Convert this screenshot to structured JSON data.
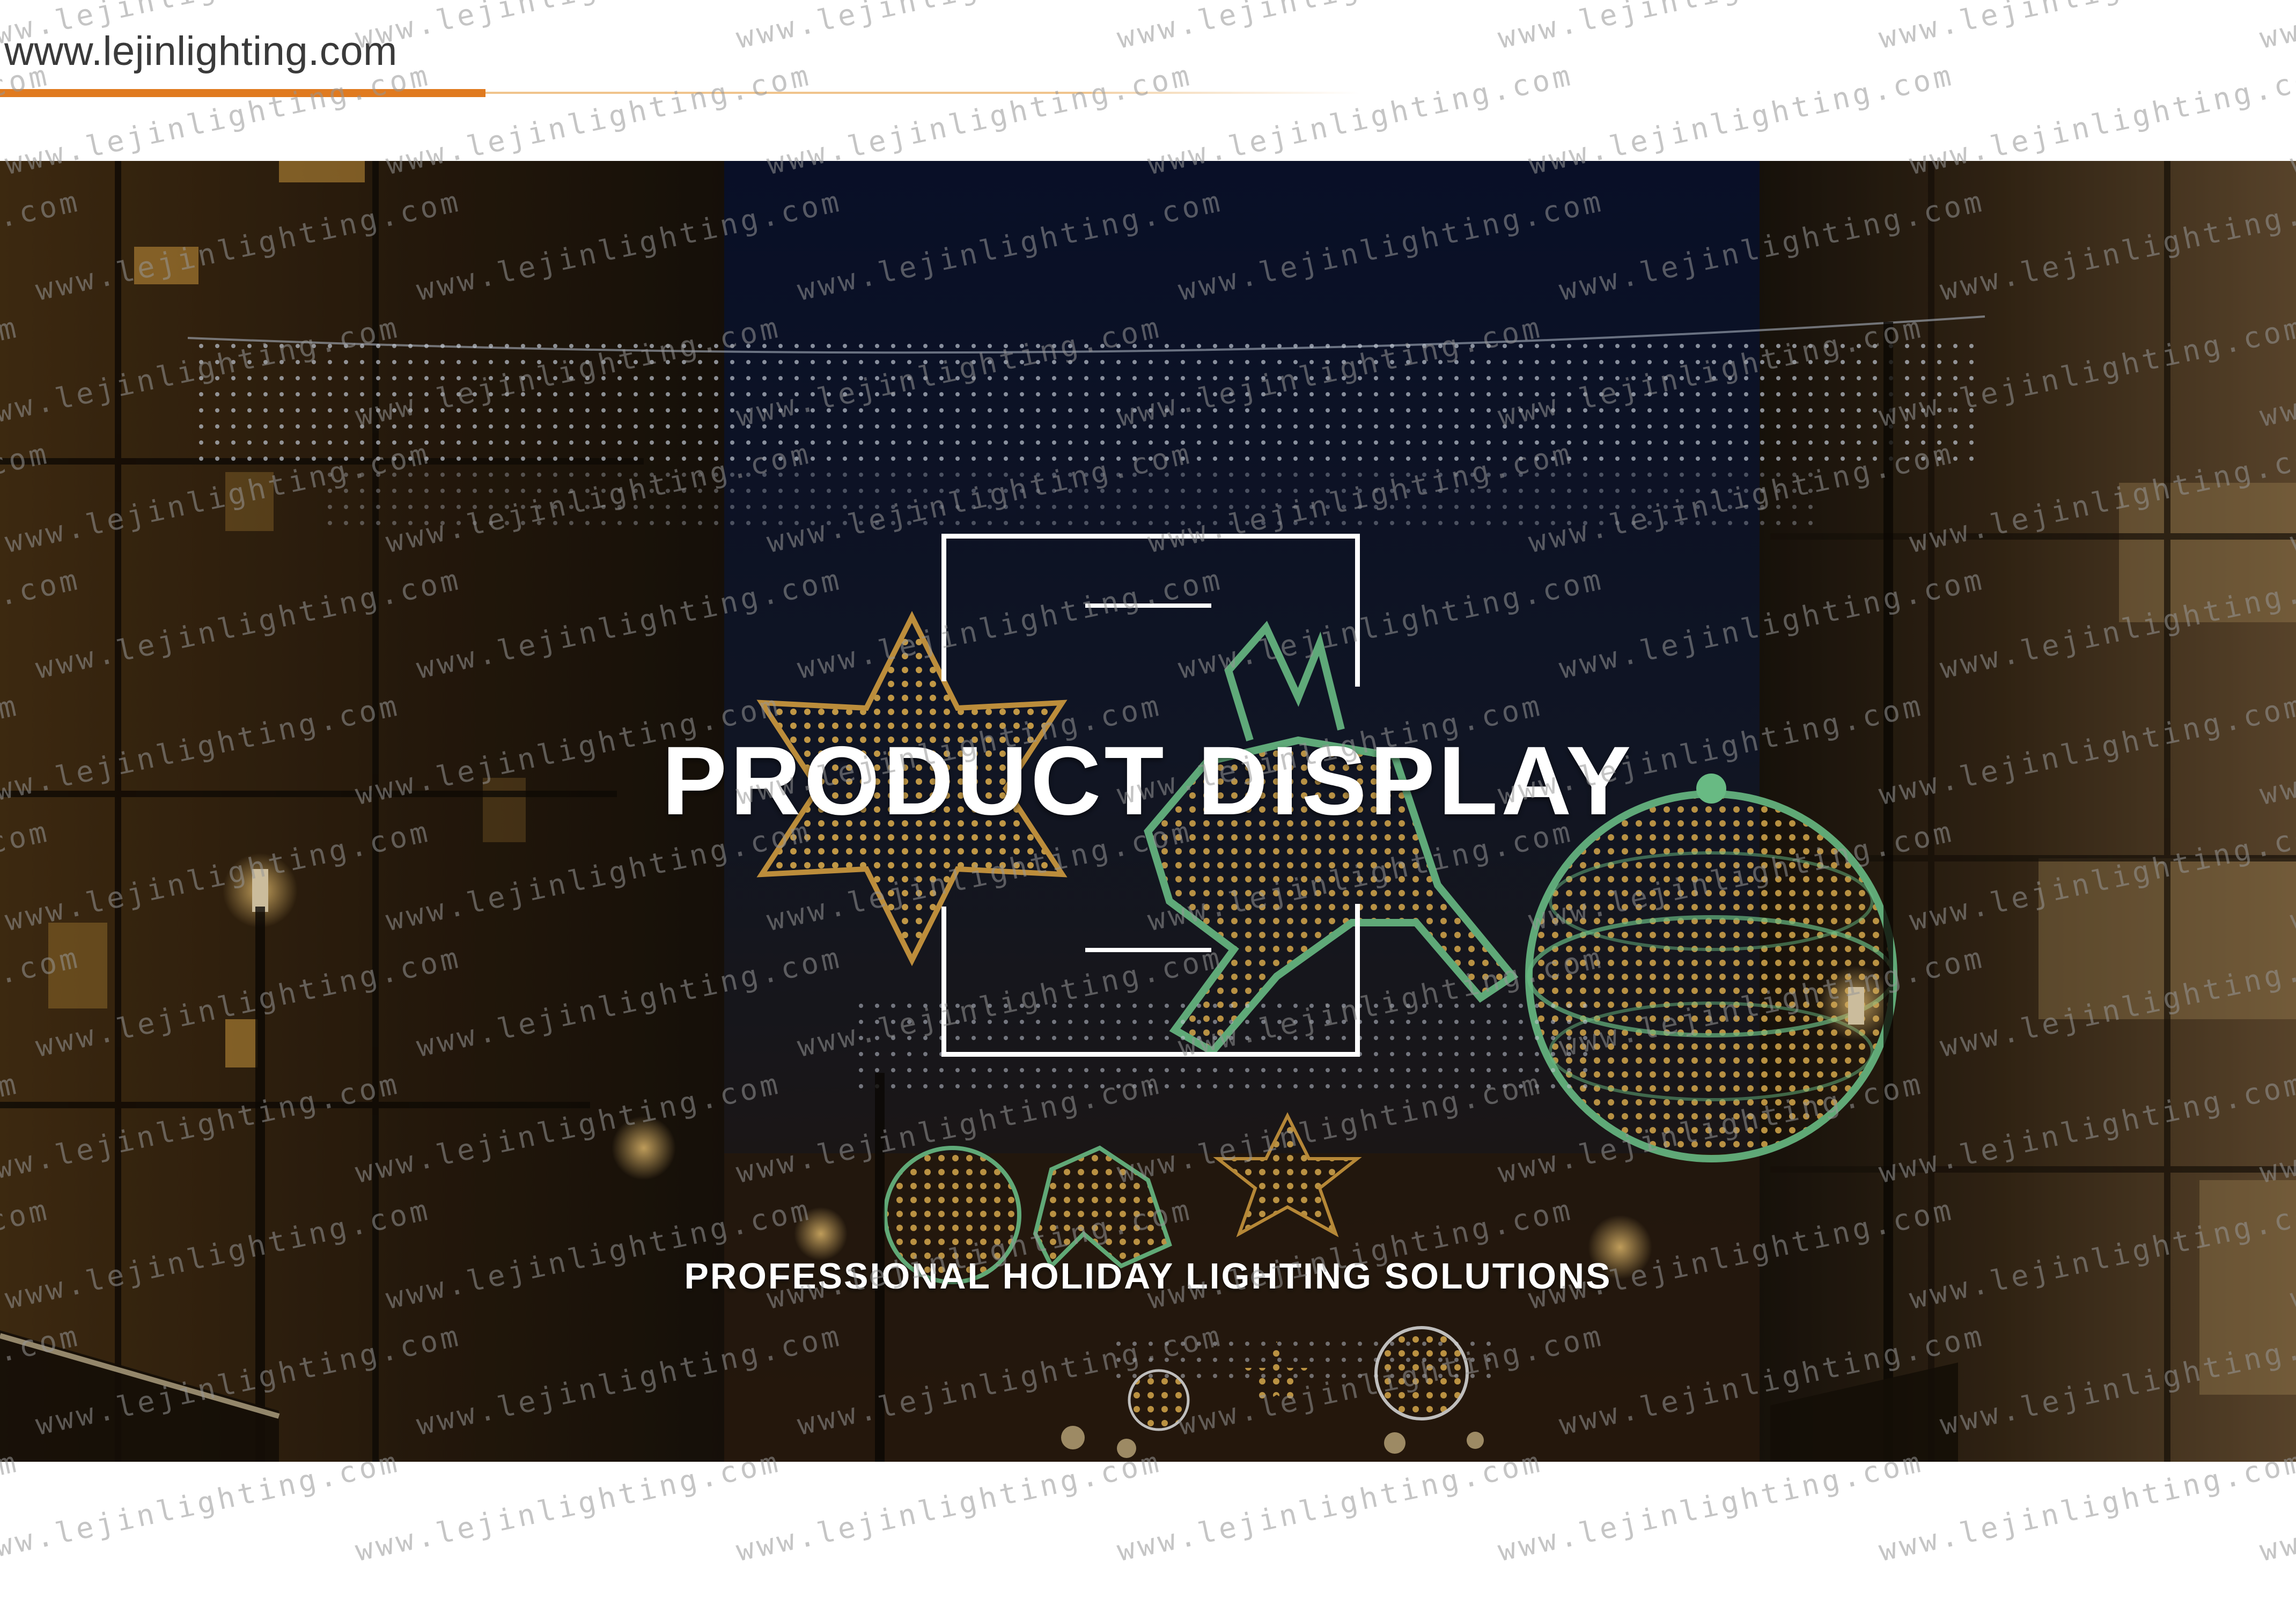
{
  "header": {
    "url": "www.lejinlighting.com"
  },
  "banner": {
    "title": "PRODUCT DISPLAY",
    "subtitle": "PROFESSIONAL HOLIDAY LIGHTING SOLUTIONS"
  },
  "watermark": {
    "text": "www.lejinlighting.com"
  },
  "colors": {
    "accent": "#e07a1f",
    "accent_light": "#f0c48c",
    "warm_light": "#f2b54a",
    "sky": "#0b1330",
    "frame": "#ffffff"
  },
  "icons": [
    "snowflake-motif-icon",
    "reindeer-motif-icon",
    "bauble-motif-icon",
    "string-lights-icon"
  ]
}
